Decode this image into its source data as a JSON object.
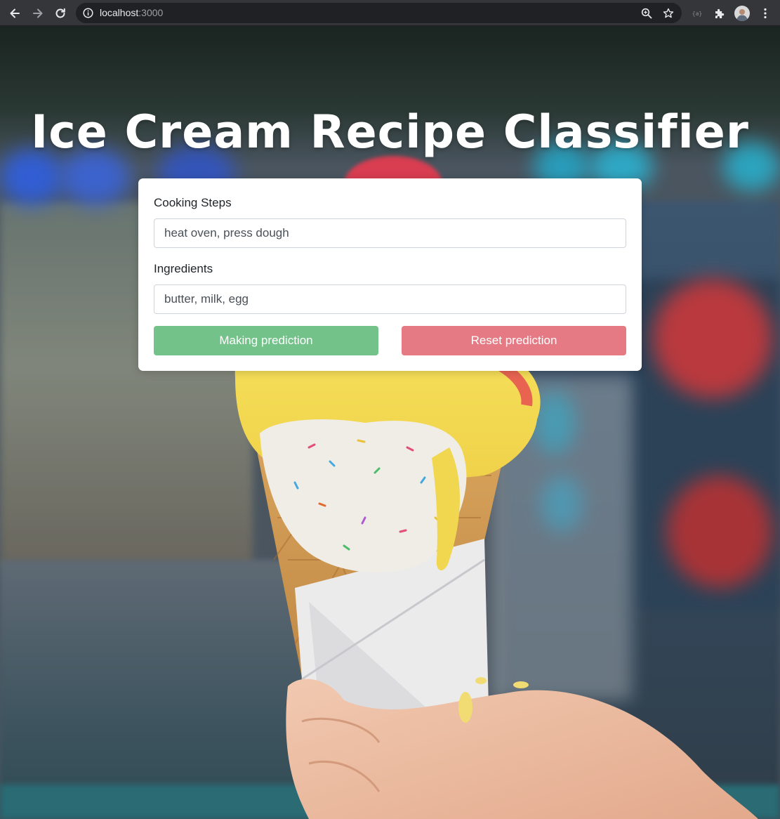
{
  "browser": {
    "url_host": "localhost",
    "url_port": ":3000",
    "icons": [
      "back-arrow-icon",
      "forward-arrow-icon",
      "reload-icon",
      "info-icon",
      "zoom-icon",
      "star-icon",
      "extension-icon",
      "puzzle-icon",
      "profile-avatar",
      "menu-dots-icon"
    ]
  },
  "page": {
    "title": "Ice Cream Recipe Classifier",
    "background": "ice-cream-cone-photo"
  },
  "form": {
    "cooking_steps": {
      "label": "Cooking Steps",
      "value": "heat oven, press dough"
    },
    "ingredients": {
      "label": "Ingredients",
      "value": "butter, milk, egg"
    },
    "predict_button": "Making prediction",
    "reset_button": "Reset prediction"
  },
  "colors": {
    "predict_button": "#73c28a",
    "reset_button": "#e67a84",
    "card": "#ffffff",
    "title": "#ffffff"
  }
}
